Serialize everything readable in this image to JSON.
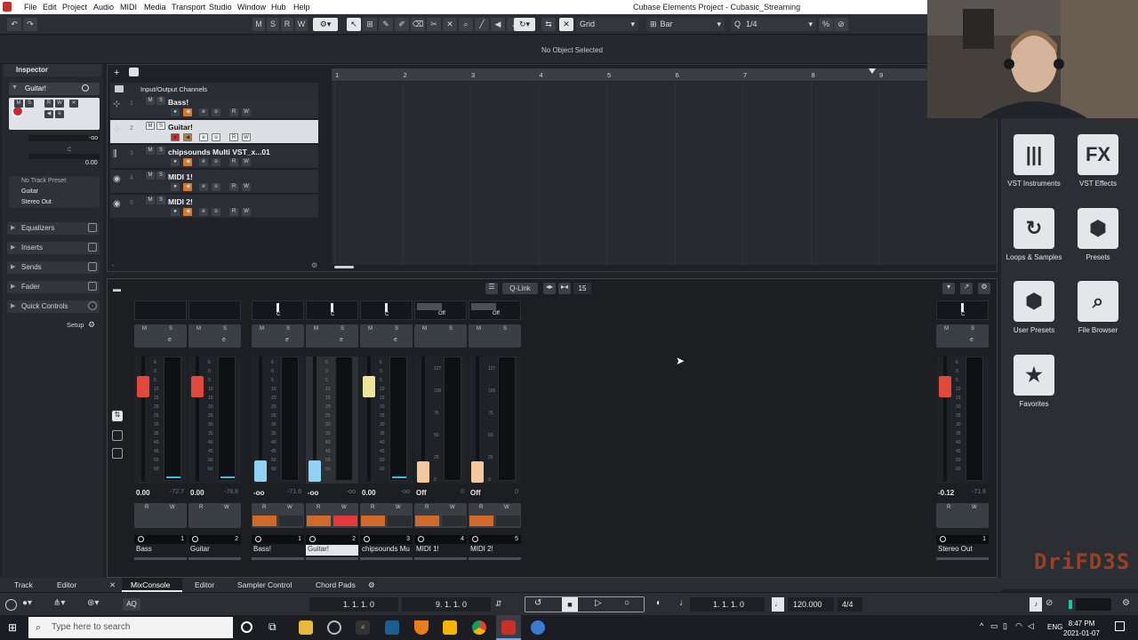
{
  "menubar": {
    "items": [
      "File",
      "Edit",
      "Project",
      "Audio",
      "MIDI",
      "Media",
      "Transport",
      "Studio",
      "Window",
      "Hub",
      "Help"
    ],
    "title": "Cubase Elements Project - Cubasic_Streaming"
  },
  "toolbar": {
    "mode_buttons": [
      "M",
      "S",
      "R",
      "W"
    ],
    "snap_type": "Grid",
    "grid_type": "Bar",
    "quantize": "1/4"
  },
  "infoline": {
    "status": "No Object Selected"
  },
  "inspector": {
    "title": "Inspector",
    "track_name": "Guitar!",
    "volume_value": "-oo",
    "pan_value": "C",
    "delay_value": "0.00",
    "preset_label": "No Track Preset",
    "input_routing": "Guitar",
    "output_routing": "Stereo Out",
    "sections": [
      "Equalizers",
      "Inserts",
      "Sends",
      "Fader",
      "Quick Controls"
    ],
    "setup_label": "Setup",
    "tabs": [
      "Track",
      "Editor"
    ]
  },
  "project": {
    "folder_label": "Input/Output Channels",
    "tracks": [
      {
        "num": "1",
        "name": "Bass!"
      },
      {
        "num": "2",
        "name": "Guitar!"
      },
      {
        "num": "3",
        "name": "chipsounds Multi VST_x...01"
      },
      {
        "num": "4",
        "name": "MIDI 1!"
      },
      {
        "num": "5",
        "name": "MIDI 2!"
      }
    ],
    "ruler": [
      "1",
      "2",
      "3",
      "4",
      "5",
      "6",
      "7",
      "8",
      "9"
    ]
  },
  "mixer": {
    "qlink_label": "Q-Link",
    "visible_count": "15",
    "channels": [
      {
        "name": "Bass",
        "num": "1",
        "value": "0.00",
        "peak": "-72.7",
        "pan": "",
        "color": "#e0483c"
      },
      {
        "name": "Guitar",
        "num": "2",
        "value": "0.00",
        "peak": "-78.8",
        "pan": "",
        "color": "#e0483c"
      },
      {
        "name": "Bass!",
        "num": "1",
        "value": "-oo",
        "peak": "-71.6",
        "pan": "C",
        "color": "#8fd4f2"
      },
      {
        "name": "Guitar!",
        "num": "2",
        "value": "-oo",
        "peak": "-oo",
        "pan": "C",
        "color": "#8fd4f2"
      },
      {
        "name": "chipsounds Mu",
        "num": "3",
        "value": "0.00",
        "peak": "-oo",
        "pan": "C",
        "color": "#ece59a"
      },
      {
        "name": "MIDI 1!",
        "num": "4",
        "value": "Off",
        "peak": "0",
        "pan": "Off",
        "color": "#f3c8a0"
      },
      {
        "name": "MIDI 2!",
        "num": "5",
        "value": "Off",
        "peak": "0",
        "pan": "Off",
        "color": "#f3c8a0"
      }
    ],
    "output": {
      "name": "Stereo Out",
      "num": "1",
      "value": "-0.12",
      "peak": "-71.6",
      "pan": "C"
    },
    "audio_scale": [
      "6",
      "0",
      "5",
      "10",
      "15",
      "20",
      "25",
      "30",
      "35",
      "40",
      "45",
      "50",
      "60"
    ],
    "midi_scale": [
      "127",
      "100",
      "75",
      "50",
      "25",
      "0"
    ]
  },
  "right_panel": {
    "items": [
      {
        "label": "VST Instruments",
        "glyph": "|||"
      },
      {
        "label": "VST Effects",
        "glyph": "FX"
      },
      {
        "label": "Loops & Samples",
        "glyph": "↻"
      },
      {
        "label": "Presets",
        "glyph": "⬢"
      },
      {
        "label": "User Presets",
        "glyph": "⬢"
      },
      {
        "label": "File Browser",
        "glyph": "⌕"
      },
      {
        "label": "Favorites",
        "glyph": "★"
      }
    ]
  },
  "bottom_tabs": [
    "MixConsole",
    "Editor",
    "Sampler Control",
    "Chord Pads"
  ],
  "watermark": "DriFD3S",
  "transport": {
    "left_locator": "1. 1. 1. 0",
    "right_locator": "9. 1. 1. 0",
    "position": "1. 1. 1. 0",
    "tempo": "120.000",
    "signature": "4/4",
    "aq_label": "AQ"
  },
  "taskbar": {
    "search_placeholder": "Type here to search",
    "lang": "ENG",
    "time": "8:47 PM",
    "date": "2021-01-07"
  }
}
